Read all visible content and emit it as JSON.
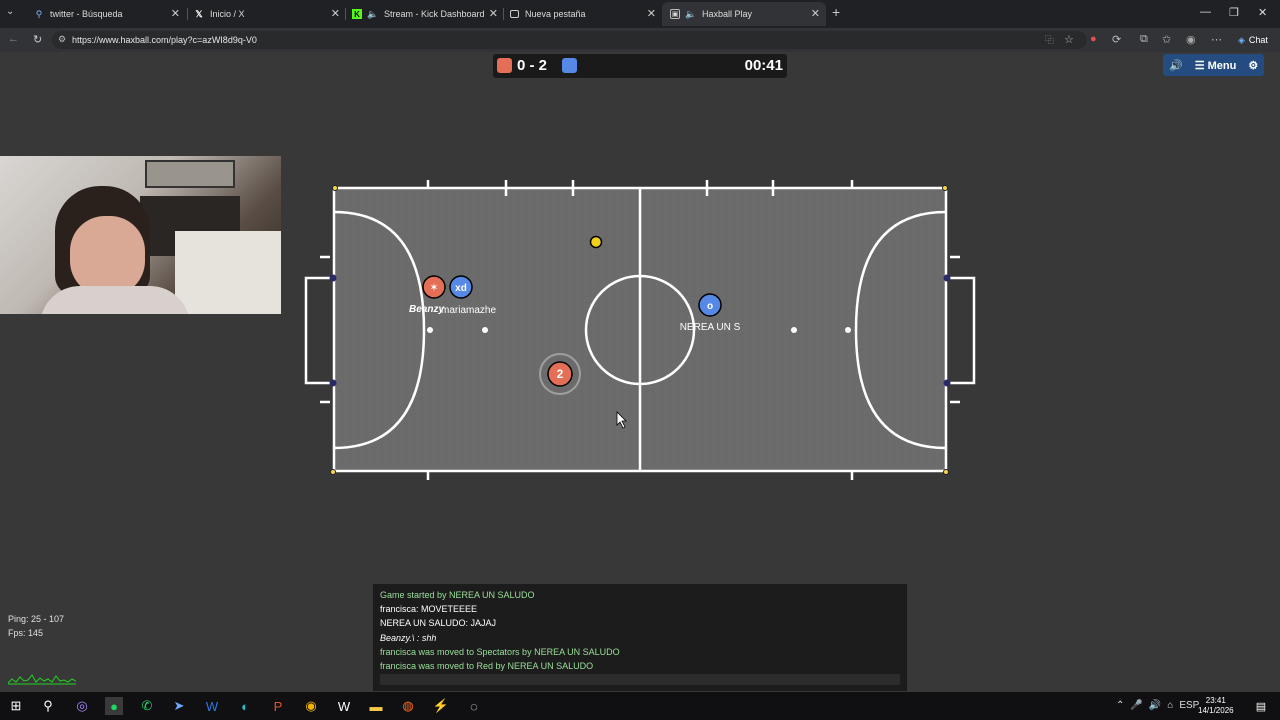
{
  "browser": {
    "tabs": [
      {
        "title": "twitter - Búsqueda",
        "icon": "search-icon",
        "active": false
      },
      {
        "title": "Inicio / X",
        "icon": "x-logo-icon",
        "active": false
      },
      {
        "title": "Stream - Kick Dashboard",
        "icon": "kick-logo-icon",
        "active": false
      },
      {
        "title": "Nueva pestaña",
        "icon": "newtab-icon",
        "active": false
      },
      {
        "title": "Haxball Play",
        "icon": "haxball-icon",
        "active": true
      }
    ],
    "url": "https://www.haxball.com/play?c=azWI8d9q-V0",
    "chat_button": "Chat"
  },
  "game": {
    "score_red": 0,
    "score_blue": 2,
    "score_text": "0 - 2",
    "timer": "00:41",
    "menu_label": "Menu",
    "red_color": "#e56e56",
    "blue_color": "#5689e5",
    "players": [
      {
        "avatar": "✶",
        "team": "red",
        "name": "Beanzy"
      },
      {
        "avatar": "xd",
        "team": "blue",
        "name": "mariamazhe"
      },
      {
        "avatar": "o",
        "team": "blue",
        "name": "NEREA UN S"
      },
      {
        "avatar": "2",
        "team": "red",
        "name": ""
      }
    ],
    "stats": {
      "ping": "Ping: 25 - 107",
      "fps": "Fps: 145"
    },
    "chat": [
      {
        "text": "Game started by NEREA UN SALUDO",
        "system": true
      },
      {
        "text": "francisca: MOVETEEEE",
        "system": false
      },
      {
        "text": "NEREA UN SALUDO: JAJAJ",
        "system": false
      },
      {
        "text": "Beanzy.\\ : shh",
        "system": false
      },
      {
        "text": "francisca was moved to Spectators by NEREA UN SALUDO",
        "system": true
      },
      {
        "text": "francisca was moved to Red by NEREA UN SALUDO",
        "system": true
      }
    ]
  },
  "taskbar": {
    "language": "ESP",
    "time": "23:41",
    "date": "14/1/2026"
  }
}
